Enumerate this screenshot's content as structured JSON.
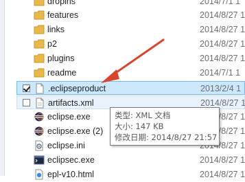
{
  "files": [
    {
      "name": "dropins",
      "date": "2014/7/1 1",
      "icon": "folder-icon"
    },
    {
      "name": "features",
      "date": "2014/8/27 1",
      "icon": "folder-icon"
    },
    {
      "name": "links",
      "date": "2014/8/27 1",
      "icon": "folder-icon"
    },
    {
      "name": "p2",
      "date": "2014/8/27 1",
      "icon": "folder-icon"
    },
    {
      "name": "plugins",
      "date": "2014/8/27 1",
      "icon": "folder-icon"
    },
    {
      "name": "readme",
      "date": "2014/7/1 1",
      "icon": "folder-icon"
    },
    {
      "name": ".eclipseproduct",
      "date": "2013/2/4 1",
      "icon": "document-icon"
    },
    {
      "name": "artifacts.xml",
      "date": "2014/8/27 1",
      "icon": "xml-file-icon"
    },
    {
      "name": "eclipse.exe",
      "date": "2014/8/27 1",
      "icon": "eclipse-app-icon"
    },
    {
      "name": "eclipse.exe (2)",
      "date": "2014/8/27 1",
      "icon": "eclipse-app-icon"
    },
    {
      "name": "eclipse.ini",
      "date": "2014/8/27 1",
      "icon": "settings-file-icon"
    },
    {
      "name": "eclipsec.exe",
      "date": "2014/8/27 1",
      "icon": "console-app-icon"
    },
    {
      "name": "epl-v10.html",
      "date": "2014/8/27 1",
      "icon": "html-file-icon"
    }
  ],
  "tooltip": {
    "type_line": "类型: XML 文档",
    "size_line": "大小: 147 KB",
    "modified_line": "修改日期: 2014/8/27 21:57"
  },
  "colors": {
    "selection": "#cce8ff",
    "folder": "#e8b84a",
    "arrow": "#d9442e"
  }
}
